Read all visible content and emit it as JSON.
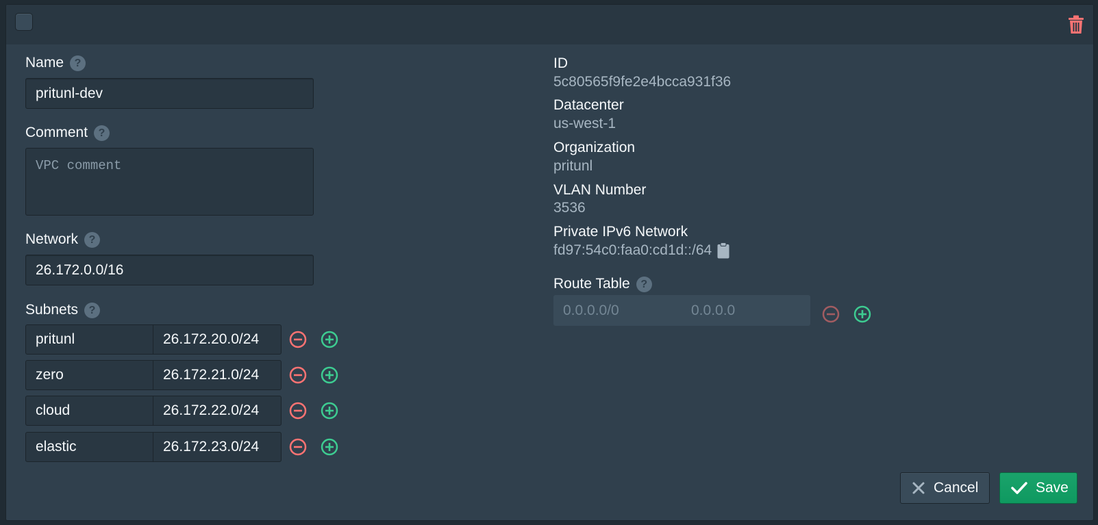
{
  "header": {
    "checkbox_icon": "checkbox-icon",
    "delete_icon": "trash-icon",
    "delete_color": "#ff7373"
  },
  "form": {
    "name": {
      "label": "Name",
      "value": "pritunl-dev"
    },
    "comment": {
      "label": "Comment",
      "placeholder": "VPC comment",
      "value": ""
    },
    "network": {
      "label": "Network",
      "value": "26.172.0.0/16"
    },
    "subnets": {
      "label": "Subnets",
      "rows": [
        {
          "name": "pritunl",
          "network": "26.172.20.0/24"
        },
        {
          "name": "zero",
          "network": "26.172.21.0/24"
        },
        {
          "name": "cloud",
          "network": "26.172.22.0/24"
        },
        {
          "name": "elastic",
          "network": "26.172.23.0/24"
        }
      ]
    }
  },
  "info": {
    "id": {
      "label": "ID",
      "value": "5c80565f9fe2e4bcca931f36"
    },
    "datacenter": {
      "label": "Datacenter",
      "value": "us-west-1"
    },
    "organization": {
      "label": "Organization",
      "value": "pritunl"
    },
    "vlan": {
      "label": "VLAN Number",
      "value": "3536"
    },
    "ipv6": {
      "label": "Private IPv6 Network",
      "value": "fd97:54c0:faa0:cd1d::/64",
      "icon": "clipboard-icon"
    }
  },
  "route_table": {
    "label": "Route Table",
    "destination_placeholder": "0.0.0.0/0",
    "target_placeholder": "0.0.0.0"
  },
  "actions": {
    "cancel_label": "Cancel",
    "save_label": "Save"
  },
  "colors": {
    "remove": "#ff7373",
    "add": "#3dcc91",
    "save": "#0f9960"
  }
}
